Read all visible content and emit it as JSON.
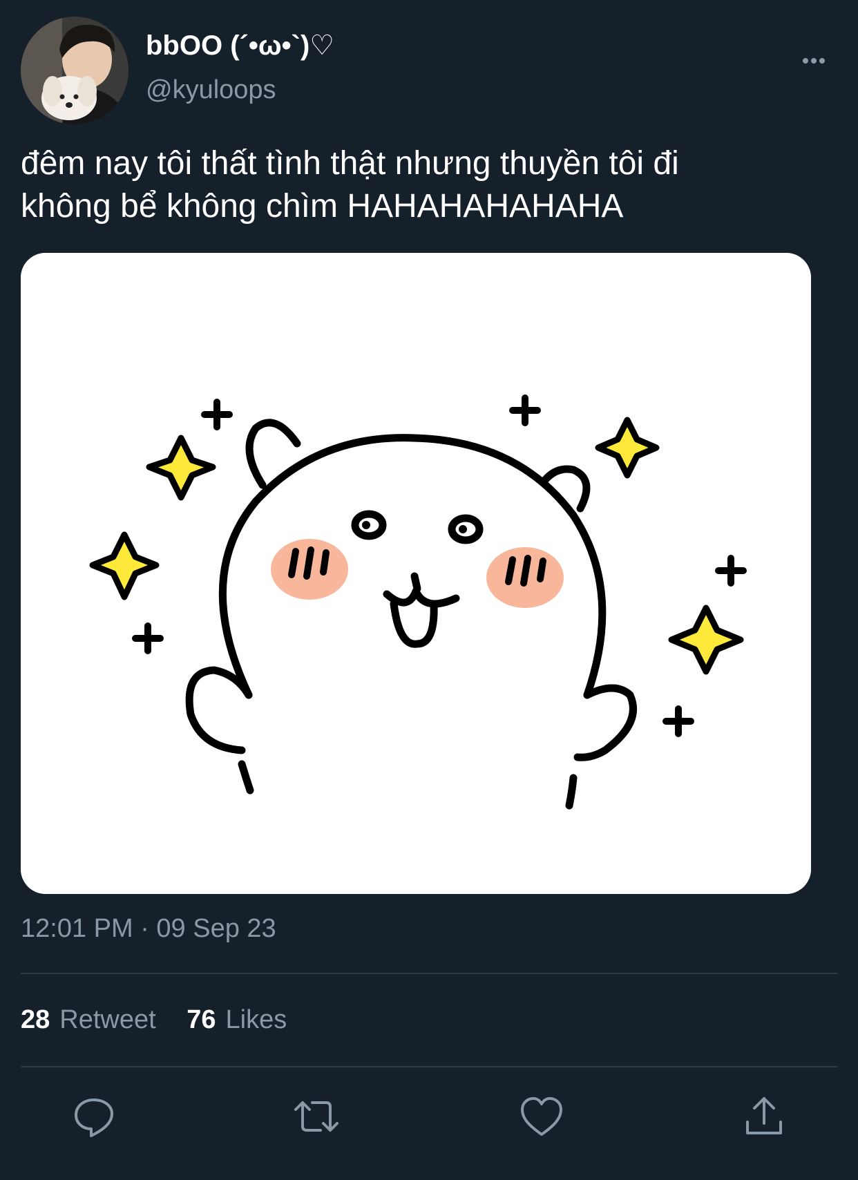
{
  "tweet": {
    "author": {
      "display_name": "bbOO (´•ω•`)♡",
      "handle": "@kyuloops"
    },
    "text_line_1": "đêm nay tôi thất tình thật nhưng thuyền tôi đi",
    "text_line_2": "không bể không chìm HAHAHAHAHAHA",
    "timestamp": "12:01 PM · 09 Sep 23"
  },
  "stats": {
    "retweets_count": "28",
    "retweets_label": "Retweet",
    "likes_count": "76",
    "likes_label": "Likes"
  },
  "actions": [
    {
      "name": "reply",
      "icon": "reply-icon"
    },
    {
      "name": "retweet",
      "icon": "retweet-icon"
    },
    {
      "name": "like",
      "icon": "heart-icon"
    },
    {
      "name": "share",
      "icon": "share-icon"
    }
  ],
  "colors": {
    "background": "#15202b",
    "secondary_text": "#8b98a5",
    "divider": "#2f3b47",
    "sticker_sparkle": "#fde93a",
    "sticker_blush": "#f7a98a"
  }
}
